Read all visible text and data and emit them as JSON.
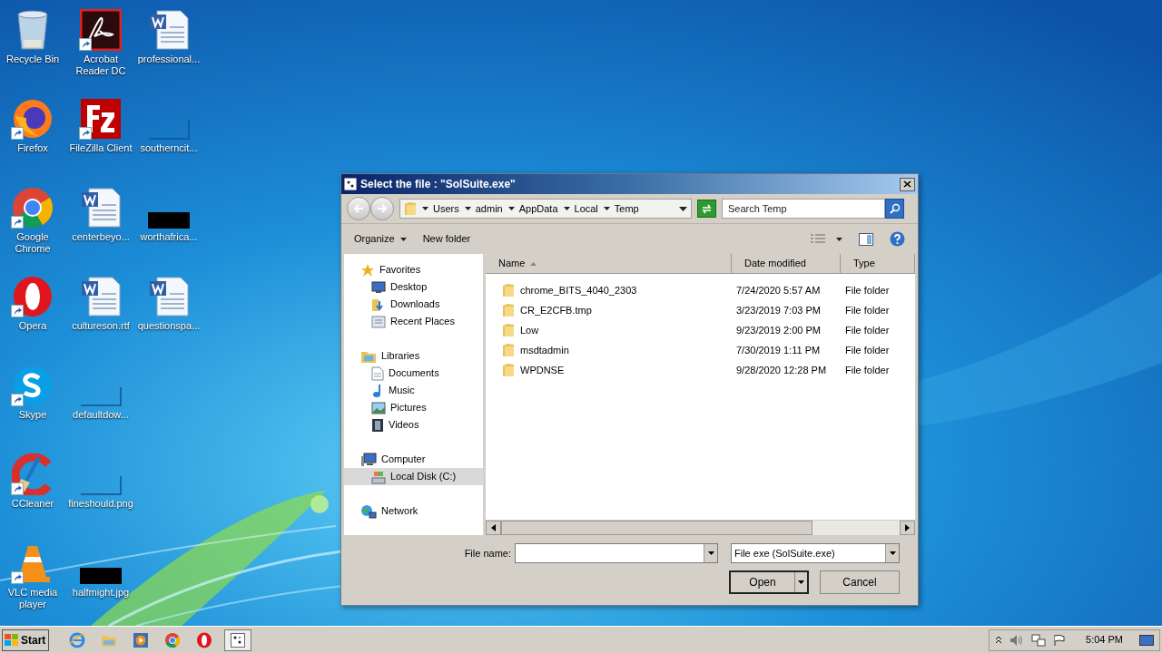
{
  "desktop": {
    "columns": [
      [
        {
          "label": "Recycle Bin",
          "kind": "recycle",
          "shortcut": false
        },
        {
          "label": "Firefox",
          "kind": "firefox",
          "shortcut": true
        },
        {
          "label": "Google Chrome",
          "kind": "chrome",
          "shortcut": true
        },
        {
          "label": "Opera",
          "kind": "opera",
          "shortcut": true
        },
        {
          "label": "Skype",
          "kind": "skype",
          "shortcut": true
        },
        {
          "label": "CCleaner",
          "kind": "ccleaner",
          "shortcut": true
        },
        {
          "label": "VLC media player",
          "kind": "vlc",
          "shortcut": true
        }
      ],
      [
        {
          "label": "Acrobat Reader DC",
          "kind": "acrobat",
          "shortcut": true
        },
        {
          "label": "FileZilla Client",
          "kind": "filezilla",
          "shortcut": true
        },
        {
          "label": "centerbeyo...",
          "kind": "word",
          "shortcut": false
        },
        {
          "label": "cultureson.rtf",
          "kind": "word",
          "shortcut": false
        },
        {
          "label": "defaultdow...",
          "kind": "blank",
          "shortcut": false
        },
        {
          "label": "fineshould.png",
          "kind": "blank",
          "shortcut": false
        },
        {
          "label": "halfmight.jpg",
          "kind": "black",
          "shortcut": false
        }
      ],
      [
        {
          "label": "professional...",
          "kind": "word",
          "shortcut": false
        },
        {
          "label": "southerncit...",
          "kind": "blank",
          "shortcut": false
        },
        {
          "label": "worthafrica...",
          "kind": "black",
          "shortcut": false
        },
        {
          "label": "questionspa...",
          "kind": "word",
          "shortcut": false
        }
      ]
    ]
  },
  "dialog": {
    "title": "Select the file : \"SolSuite.exe\"",
    "breadcrumbs": [
      "Users",
      "admin",
      "AppData",
      "Local",
      "Temp"
    ],
    "search": {
      "placeholder": "Search Temp"
    },
    "toolbar": {
      "organize": "Organize",
      "new_folder": "New folder"
    },
    "navigation": [
      {
        "label": "Favorites",
        "kind": "favorites",
        "selected": false,
        "children": [
          {
            "label": "Desktop",
            "kind": "desktop",
            "selected": false
          },
          {
            "label": "Downloads",
            "kind": "downloads",
            "selected": false
          },
          {
            "label": "Recent Places",
            "kind": "recent",
            "selected": false
          }
        ]
      },
      {
        "label": "Libraries",
        "kind": "libraries",
        "selected": false,
        "children": [
          {
            "label": "Documents",
            "kind": "documents",
            "selected": false
          },
          {
            "label": "Music",
            "kind": "music",
            "selected": false
          },
          {
            "label": "Pictures",
            "kind": "pictures",
            "selected": false
          },
          {
            "label": "Videos",
            "kind": "videos",
            "selected": false
          }
        ]
      },
      {
        "label": "Computer",
        "kind": "computer",
        "selected": false,
        "children": [
          {
            "label": "Local Disk (C:)",
            "kind": "disk",
            "selected": true
          }
        ]
      },
      {
        "label": "Network",
        "kind": "network",
        "selected": false
      }
    ],
    "columns": [
      {
        "label": "Name",
        "sorted": true
      },
      {
        "label": "Date modified",
        "sorted": false
      },
      {
        "label": "Type",
        "sorted": false
      }
    ],
    "rows": [
      {
        "name": "chrome_BITS_4040_2303",
        "date": "7/24/2020 5:57 AM",
        "type": "File folder"
      },
      {
        "name": "CR_E2CFB.tmp",
        "date": "3/23/2019 7:03 PM",
        "type": "File folder"
      },
      {
        "name": "Low",
        "date": "9/23/2019 2:00 PM",
        "type": "File folder"
      },
      {
        "name": "msdtadmin",
        "date": "7/30/2019 1:11 PM",
        "type": "File folder"
      },
      {
        "name": "WPDNSE",
        "date": "9/28/2020 12:28 PM",
        "type": "File folder"
      }
    ],
    "file_name": {
      "label": "File name:"
    },
    "file_type": "File exe (SolSuite.exe)",
    "buttons": {
      "open": "Open",
      "cancel": "Cancel"
    }
  },
  "taskbar": {
    "start": "Start",
    "apps": [
      {
        "kind": "ie",
        "selected": false
      },
      {
        "kind": "explorer",
        "selected": false
      },
      {
        "kind": "media",
        "selected": false
      },
      {
        "kind": "chrome",
        "selected": false
      },
      {
        "kind": "opera",
        "selected": false
      },
      {
        "kind": "app",
        "selected": true
      }
    ],
    "clock": "5:04 PM"
  }
}
